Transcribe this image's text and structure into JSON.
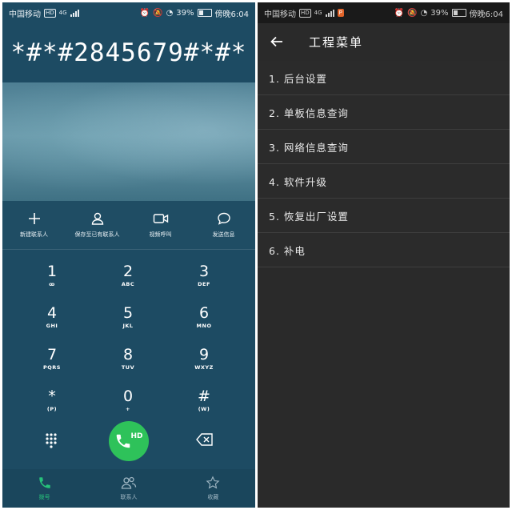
{
  "status": {
    "carrier": "中国移动",
    "hd_tag": "HD",
    "net_tag": "4G",
    "battery": "39%",
    "time": "傍晚6:04",
    "notif_tag": "P"
  },
  "dialer": {
    "number": "*#*#2845679#*#*",
    "actions": [
      {
        "label": "新建联系人",
        "icon": "plus-icon"
      },
      {
        "label": "保存至已有联系人",
        "icon": "person-icon"
      },
      {
        "label": "视频呼叫",
        "icon": "video-icon"
      },
      {
        "label": "发送信息",
        "icon": "message-icon"
      }
    ],
    "keys": [
      {
        "digit": "1",
        "letters": "ꝏ"
      },
      {
        "digit": "2",
        "letters": "ABC"
      },
      {
        "digit": "3",
        "letters": "DEF"
      },
      {
        "digit": "4",
        "letters": "GHI"
      },
      {
        "digit": "5",
        "letters": "JKL"
      },
      {
        "digit": "6",
        "letters": "MNO"
      },
      {
        "digit": "7",
        "letters": "PQRS"
      },
      {
        "digit": "8",
        "letters": "TUV"
      },
      {
        "digit": "9",
        "letters": "WXYZ"
      },
      {
        "digit": "*",
        "letters": "(P)"
      },
      {
        "digit": "0",
        "letters": "+"
      },
      {
        "digit": "#",
        "letters": "(W)"
      }
    ],
    "call_label": "HD",
    "tabs": [
      {
        "label": "拨号",
        "icon": "phone-icon",
        "active": true
      },
      {
        "label": "联系人",
        "icon": "contacts-icon",
        "active": false
      },
      {
        "label": "收藏",
        "icon": "star-icon",
        "active": false
      }
    ],
    "accent_color": "#2ec25a"
  },
  "engineering": {
    "title": "工程菜单",
    "items": [
      "1. 后台设置",
      "2. 单板信息查询",
      "3. 网络信息查询",
      "4. 软件升级",
      "5. 恢复出厂设置",
      "6. 补电"
    ]
  }
}
